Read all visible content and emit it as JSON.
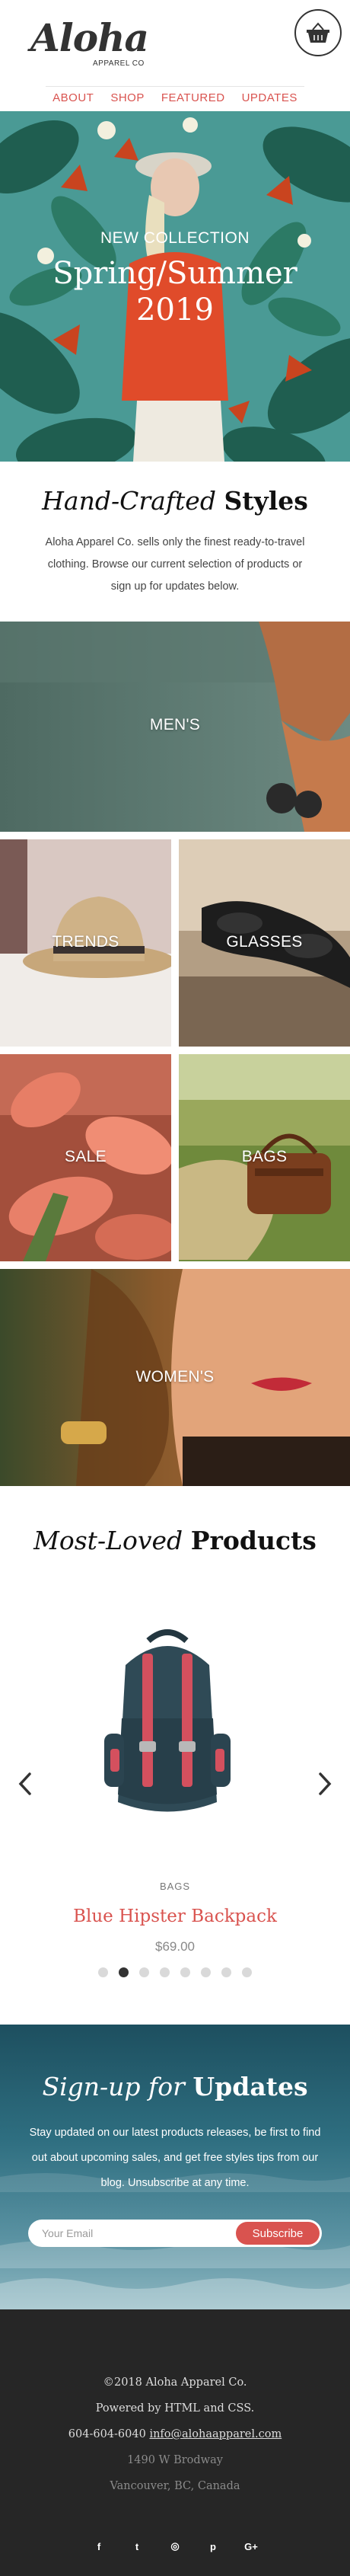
{
  "brand": {
    "logo_script": "Aloha",
    "logo_subtitle": "APPAREL CO"
  },
  "header": {
    "cart_icon": "basket-icon"
  },
  "nav": {
    "items": [
      {
        "label": "ABOUT"
      },
      {
        "label": "SHOP"
      },
      {
        "label": "FEATURED"
      },
      {
        "label": "UPDATES"
      }
    ]
  },
  "hero": {
    "kicker": "NEW COLLECTION",
    "title_line1": "Spring/Summer",
    "title_line2": "2019"
  },
  "intro": {
    "title_italic": "Hand-Crafted",
    "title_bold": "Styles",
    "body": "Aloha Apparel Co. sells only the finest ready-to-travel clothing. Browse our current selection of products or sign up for updates below."
  },
  "categories": {
    "men": "MEN'S",
    "trends": "TRENDS",
    "glasses": "GLASSES",
    "sale": "SALE",
    "bags": "BAGS",
    "women": "WOMEN'S"
  },
  "products": {
    "title_italic": "Most-Loved",
    "title_bold": "Products",
    "prev_icon": "chevron-left-icon",
    "next_icon": "chevron-right-icon",
    "item": {
      "category": "BAGS",
      "name": "Blue Hipster Backpack",
      "price": "$69.00"
    },
    "slide_count": 8,
    "active_slide": 2
  },
  "signup": {
    "title_italic": "Sign-up for",
    "title_bold": "Updates",
    "body": "Stay updated on our latest products releases, be first to find out about upcoming sales, and get free styles tips from our blog. Unsubscribe at any time.",
    "email_placeholder": "Your Email",
    "button_label": "Subscribe"
  },
  "footer": {
    "copyright": "©2018 Aloha Apparel Co.",
    "powered": "Powered by HTML and CSS.",
    "phone": "604-604-6040",
    "email": "info@alohaapparel.com",
    "street": "1490 W Brodway",
    "city": "Vancouver, BC, Canada",
    "social": [
      {
        "icon": "facebook-icon",
        "glyph": "f"
      },
      {
        "icon": "twitter-icon",
        "glyph": "t"
      },
      {
        "icon": "instagram-icon",
        "glyph": "◎"
      },
      {
        "icon": "pinterest-icon",
        "glyph": "p"
      },
      {
        "icon": "google-plus-icon",
        "glyph": "G+"
      }
    ]
  },
  "colors": {
    "accent": "#d9534f",
    "footer_bg": "#262626",
    "text_dark": "#111111"
  }
}
